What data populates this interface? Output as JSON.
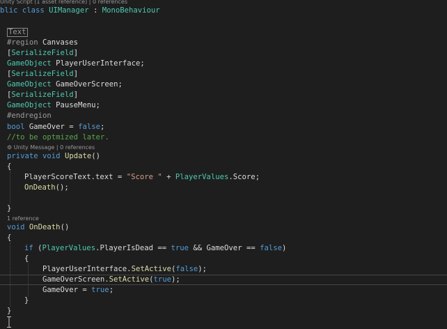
{
  "code_lens": {
    "class": "Unity Script (1 asset reference) | 0 references",
    "update": "Unity Message | 0 references",
    "ondeath": "1 reference"
  },
  "colors": {
    "background": "#1e1e1e",
    "keyword": "#569cd6",
    "type": "#4ec9b0",
    "string": "#d69d85",
    "comment": "#57a64a",
    "preprocessor": "#9b9b9b",
    "method": "#dcdcaa",
    "identifier": "#dcdcdc"
  },
  "code": {
    "class_frag": "blic ",
    "class_kw": "class",
    "class_name": "UIManager",
    "class_colon": " : ",
    "class_base": "MonoBehaviour",
    "text_token": "Text",
    "region_kw": "#region",
    "region_name": " Canvases",
    "attr_open": "[",
    "attr_name": "SerializeField",
    "attr_close": "]",
    "gameobject": "GameObject",
    "field1": " PlayerUserInterface;",
    "field2": " GameOverScreen;",
    "field3": " PauseMenu;",
    "endregion": "#endregion",
    "bool_kw": "bool",
    "gameover_decl": " GameOver = ",
    "false_kw": "false",
    "semicolon": ";",
    "comment": "//to be optmized later.",
    "private_kw": "private",
    "void_kw": "void",
    "update_name": "Update",
    "parens": "()",
    "brace_open": "{",
    "brace_close": "}",
    "score_lhs": "PlayerScoreText.text = ",
    "score_str": "\"Score \"",
    "plus": " + ",
    "player_values": "PlayerValues",
    "score_tail": ".Score;",
    "ondeath_call": "OnDeath",
    "call_end": "();",
    "ondeath_name": "OnDeath",
    "if_kw": "if",
    "if_open": " (",
    "is_dead": ".PlayerIsDead == ",
    "true_kw": "true",
    "and_gameover": " && GameOver == ",
    "if_close": ")",
    "pui_name": "PlayerUserInterface.",
    "setactive": "SetActive",
    "paren_open": "(",
    "call_close": ");",
    "gos_name": "GameOverScreen.",
    "gameover_assign": "GameOver = ",
    "cursor_glyph": "I"
  }
}
